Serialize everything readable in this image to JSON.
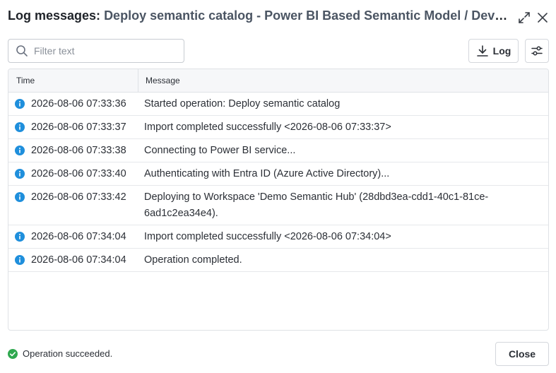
{
  "dialog": {
    "title_prefix": "Log messages:",
    "title_subject": "Deploy semantic catalog - Power BI Based Semantic Model / Deve...",
    "expand_icon": "expand-icon",
    "close_icon": "close-icon"
  },
  "toolbar": {
    "filter_placeholder": "Filter text",
    "filter_value": "",
    "log_label": "Log",
    "download_icon": "download-icon",
    "settings_icon": "sliders-icon"
  },
  "table": {
    "columns": [
      "Time",
      "Message"
    ],
    "rows": [
      {
        "level": "info",
        "time": "2026-08-06 07:33:36",
        "message": "Started operation: Deploy semantic catalog"
      },
      {
        "level": "info",
        "time": "2026-08-06 07:33:37",
        "message": "Import completed successfully <2026-08-06 07:33:37>"
      },
      {
        "level": "info",
        "time": "2026-08-06 07:33:38",
        "message": "Connecting to Power BI service..."
      },
      {
        "level": "info",
        "time": "2026-08-06 07:33:40",
        "message": "Authenticating with Entra ID (Azure Active Directory)..."
      },
      {
        "level": "info",
        "time": "2026-08-06 07:33:42",
        "message": "Deploying to Workspace 'Demo Semantic Hub' (28dbd3ea-cdd1-40c1-81ce-6ad1c2ea34e4)."
      },
      {
        "level": "info",
        "time": "2026-08-06 07:34:04",
        "message": "Import completed successfully <2026-08-06 07:34:04>"
      },
      {
        "level": "info",
        "time": "2026-08-06 07:34:04",
        "message": "Operation completed."
      }
    ]
  },
  "footer": {
    "status_text": "Operation succeeded.",
    "close_label": "Close"
  },
  "colors": {
    "info": "#1f8fdc",
    "success": "#2fa84f"
  }
}
